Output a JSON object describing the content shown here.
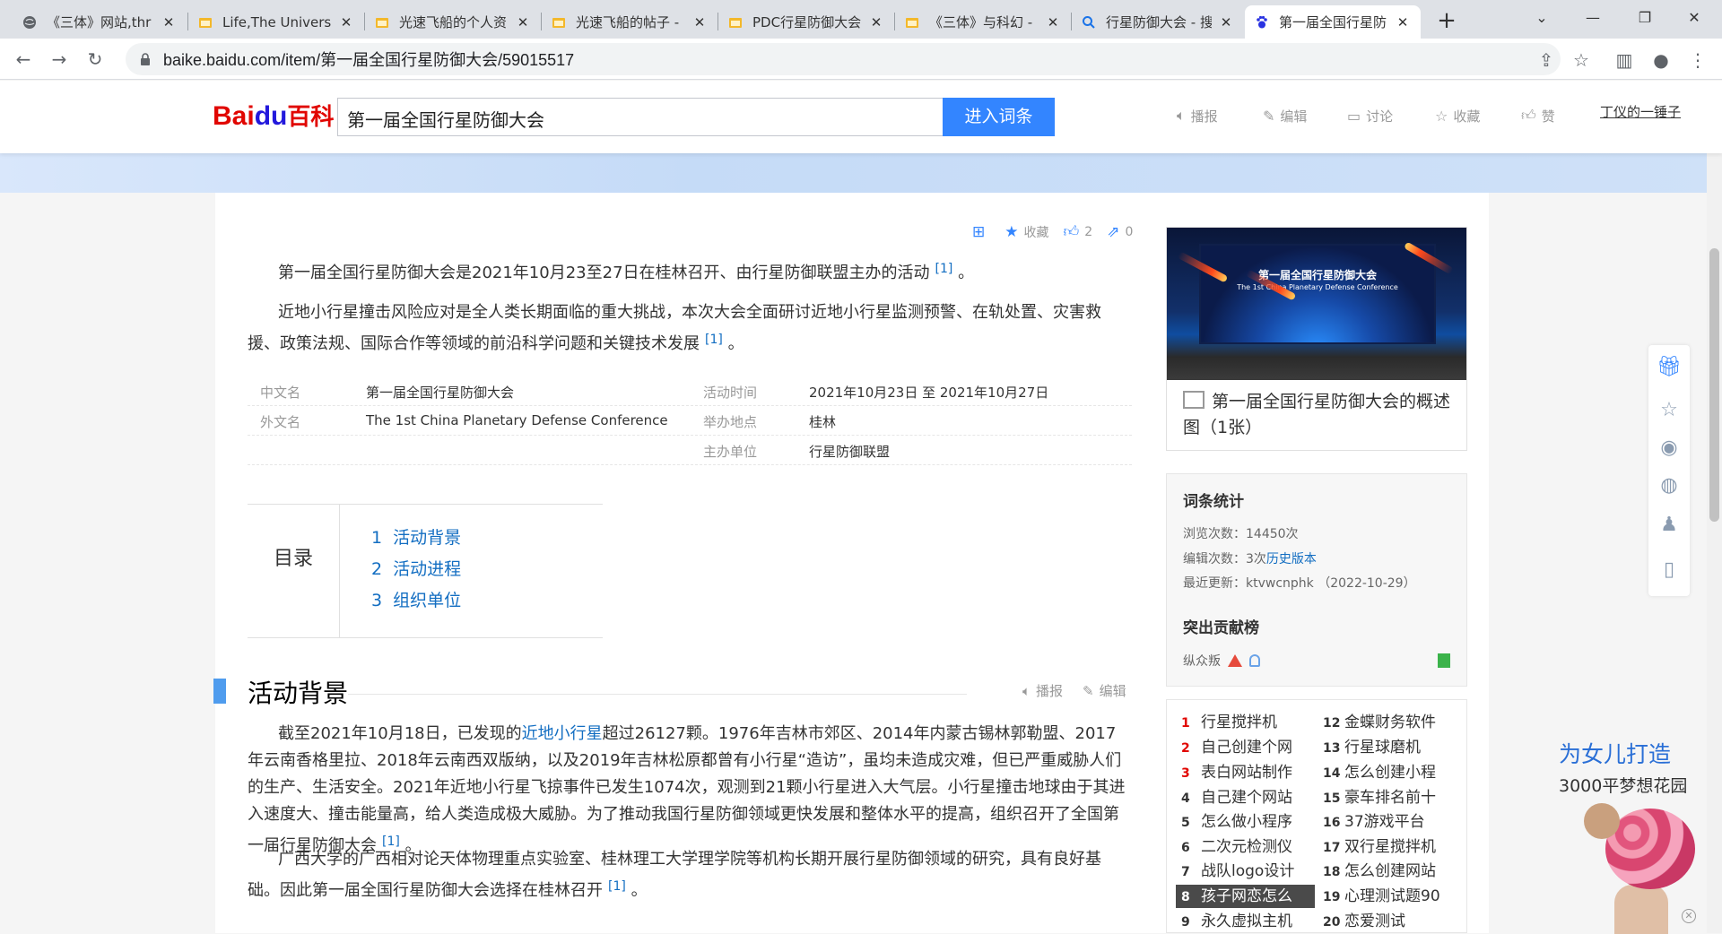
{
  "browser": {
    "tabs": [
      {
        "title": "《三体》网站,thr",
        "icon": "globe-icon",
        "active": false
      },
      {
        "title": "Life,The Universe",
        "icon": "folder-icon",
        "active": false
      },
      {
        "title": "光速飞船的个人资",
        "icon": "folder-icon",
        "active": false
      },
      {
        "title": "光速飞船的帖子 -",
        "icon": "folder-icon",
        "active": false
      },
      {
        "title": "PDC行星防御大会",
        "icon": "folder-icon",
        "active": false
      },
      {
        "title": "《三体》与科幻 -",
        "icon": "folder-icon",
        "active": false
      },
      {
        "title": "行星防御大会 - 搜",
        "icon": "search-icon",
        "active": false
      },
      {
        "title": "第一届全国行星防",
        "icon": "baidu-paw-icon",
        "active": true
      }
    ],
    "url": "baike.baidu.com/item/第一届全国行星防御大会/59015517"
  },
  "header": {
    "logo_bai": "Bai",
    "logo_du": "du",
    "logo_baike": "百科",
    "search_value": "第一届全国行星防御大会",
    "search_button": "进入词条",
    "actions": [
      {
        "icon": "speaker-icon",
        "label": "播报"
      },
      {
        "icon": "pencil-icon",
        "label": "编辑"
      },
      {
        "icon": "comment-icon",
        "label": "讨论"
      },
      {
        "icon": "star-icon",
        "label": "收藏"
      },
      {
        "icon": "thumbs-up-icon",
        "label": "赞"
      }
    ],
    "user": "丁仪的一锤子"
  },
  "article_tools": {
    "collect": "收藏",
    "likes": "2",
    "shares": "0"
  },
  "summary": {
    "p1": "第一届全国行星防御大会是2021年10月23至27日在桂林召开、由行星防御联盟主办的活动",
    "p1_ref": "[1]",
    "p1_end": "。",
    "p2": "近地小行星撞击风险应对是全人类长期面临的重大挑战，本次大会全面研讨近地小行星监测预警、在轨处置、灾害救援、政策法规、国际合作等领域的前沿科学问题和关键技术发展",
    "p2_ref": "[1]",
    "p2_end": "。"
  },
  "basic_info": [
    {
      "name": "中文名",
      "value": "第一届全国行星防御大会",
      "name2": "活动时间",
      "value2": "2021年10月23日 至 2021年10月27日"
    },
    {
      "name": "外文名",
      "value": "The 1st China Planetary Defense Conference",
      "name2": "举办地点",
      "value2": "桂林"
    },
    {
      "name": "",
      "value": "",
      "name2": "主办单位",
      "value2": "行星防御联盟"
    }
  ],
  "toc": {
    "title": "目录",
    "items": [
      {
        "num": "1",
        "label": "活动背景"
      },
      {
        "num": "2",
        "label": "活动进程"
      },
      {
        "num": "3",
        "label": "组织单位"
      }
    ]
  },
  "section1": {
    "title": "活动背景",
    "read": "播报",
    "edit": "编辑",
    "p1_a": "截至2021年10月18日，已发现的",
    "p1_link": "近地小行星",
    "p1_b": "超过26127颗。1976年吉林市郊区、2014年内蒙古锡林郭勒盟、2017年云南香格里拉、2018年云南西双版纳，以及2019年吉林松原都曾有小行星“造访”，虽均未造成灾难，但已严重威胁人们的生产、生活安全。2021年近地小行星飞掠事件已发生1074次，观测到21颗小行星进入大气层。小行星撞击地球由于其进入速度大、撞击能量高，给人类造成极大威胁。为了推动我国行星防御领域更快发展和整体水平的提高，组织召开了全国第一届行星防御大会",
    "p1_ref": "[1]",
    "p1_end": "。",
    "p2": "广西大学的广西相对论天体物理重点实验室、桂林理工大学理学院等机构长期开展行星防御领域的研究，具有良好基础。因此第一届全国行星防御大会选择在桂林召开",
    "p2_ref": "[1]",
    "p2_end": "。"
  },
  "album": {
    "screen_title": "第一届全国行星防御大会",
    "screen_subtitle": "The 1st China Planetary Defense Conference",
    "caption": "第一届全国行星防御大会的概述图（1张）"
  },
  "stats": {
    "title": "词条统计",
    "views_label": "浏览次数：",
    "views_value": "14450次",
    "edits_label": "编辑次数：",
    "edits_value": "3次",
    "history_link": "历史版本",
    "updated_label": "最近更新：",
    "updated_value": "ktvwcnphk （2022-10-29）",
    "contrib_title": "突出贡献榜",
    "contrib_user": "纵众叛"
  },
  "hot_list": [
    {
      "num": "1",
      "label": "行星搅拌机"
    },
    {
      "num": "2",
      "label": "自己创建个网"
    },
    {
      "num": "3",
      "label": "表白网站制作"
    },
    {
      "num": "4",
      "label": "自己建个网站"
    },
    {
      "num": "5",
      "label": "怎么做小程序"
    },
    {
      "num": "6",
      "label": "二次元检测仪"
    },
    {
      "num": "7",
      "label": "战队logo设计"
    },
    {
      "num": "8",
      "label": "孩子网恋怎么"
    },
    {
      "num": "9",
      "label": "永久虚拟主机"
    },
    {
      "num": "12",
      "label": "金蝶财务软件"
    },
    {
      "num": "13",
      "label": "行星球磨机"
    },
    {
      "num": "14",
      "label": "怎么创建小程"
    },
    {
      "num": "15",
      "label": "豪车排名前十"
    },
    {
      "num": "16",
      "label": "37游戏平台"
    },
    {
      "num": "17",
      "label": "双行星搅拌机"
    },
    {
      "num": "18",
      "label": "怎么创建网站"
    },
    {
      "num": "19",
      "label": "心理测试题90"
    },
    {
      "num": "20",
      "label": "恋爱测试"
    }
  ],
  "ad": {
    "line1": "为女儿打造",
    "line2": "3000平梦想花园"
  },
  "colors": {
    "brand_blue": "#3385ff",
    "link": "#136ec2",
    "baidu_red": "#e10601"
  }
}
